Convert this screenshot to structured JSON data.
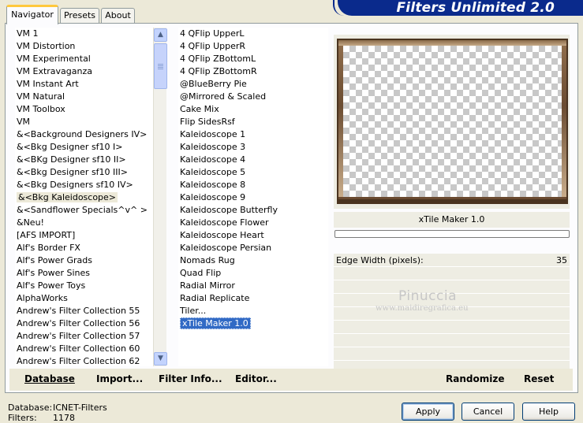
{
  "banner": {
    "title": "Filters Unlimited 2.0"
  },
  "tabs": [
    {
      "label": "Navigator",
      "active": true
    },
    {
      "label": "Presets",
      "active": false
    },
    {
      "label": "About",
      "active": false
    }
  ],
  "categories": [
    "VM 1",
    "VM Distortion",
    "VM Experimental",
    "VM Extravaganza",
    "VM Instant Art",
    "VM Natural",
    "VM Toolbox",
    "VM",
    "&<Background Designers IV>",
    "&<Bkg Designer sf10 I>",
    "&<BKg Designer sf10 II>",
    "&<Bkg Designer sf10 III>",
    "&<Bkg Designers sf10 IV>",
    "&<Bkg Kaleidoscope>",
    "&<Sandflower Specials^v^ >",
    "&Neu!",
    "[AFS IMPORT]",
    "Alf's Border FX",
    "Alf's Power Grads",
    "Alf's Power Sines",
    "Alf's Power Toys",
    "AlphaWorks",
    "Andrew's Filter Collection 55",
    "Andrew's Filter Collection 56",
    "Andrew's Filter Collection 57",
    "Andrew's Filter Collection 60",
    "Andrew's Filter Collection 62"
  ],
  "selected_category": "&<Bkg Kaleidoscope>",
  "filters": [
    "4 QFlip UpperL",
    "4 QFlip UpperR",
    "4 QFlip ZBottomL",
    "4 QFlip ZBottomR",
    "@BlueBerry Pie",
    "@Mirrored & Scaled",
    "Cake Mix",
    "Flip SidesRsf",
    "Kaleidoscope 1",
    "Kaleidoscope 3",
    "Kaleidoscope 4",
    "Kaleidoscope 5",
    "Kaleidoscope 8",
    "Kaleidoscope 9",
    "Kaleidoscope Butterfly",
    "Kaleidoscope Flower",
    "Kaleidoscope Heart",
    "Kaleidoscope Persian",
    "Nomads Rug",
    "Quad Flip",
    "Radial Mirror",
    "Radial Replicate",
    "Tiler...",
    "xTile Maker 1.0"
  ],
  "selected_filter": "xTile Maker 1.0",
  "preview": {
    "filter_name": "xTile Maker 1.0",
    "progress": 0
  },
  "params": [
    {
      "label": "Edge Width (pixels):",
      "value": "35"
    }
  ],
  "watermark": {
    "name": "Pinuccia",
    "site": "www.maidiregrafica.eu"
  },
  "bottom_links": {
    "database": "Database",
    "import": "Import...",
    "filter_info": "Filter Info...",
    "editor": "Editor...",
    "randomize": "Randomize",
    "reset": "Reset"
  },
  "status": {
    "database_label": "Database:",
    "database_value": "ICNET-Filters",
    "filters_label": "Filters:",
    "filters_value": "1178"
  },
  "buttons": {
    "apply": "Apply",
    "cancel": "Cancel",
    "help": "Help"
  },
  "colors": {
    "banner": "#0a2a8c",
    "selection": "#316ac5",
    "tab_highlight": "#ffc83c"
  }
}
